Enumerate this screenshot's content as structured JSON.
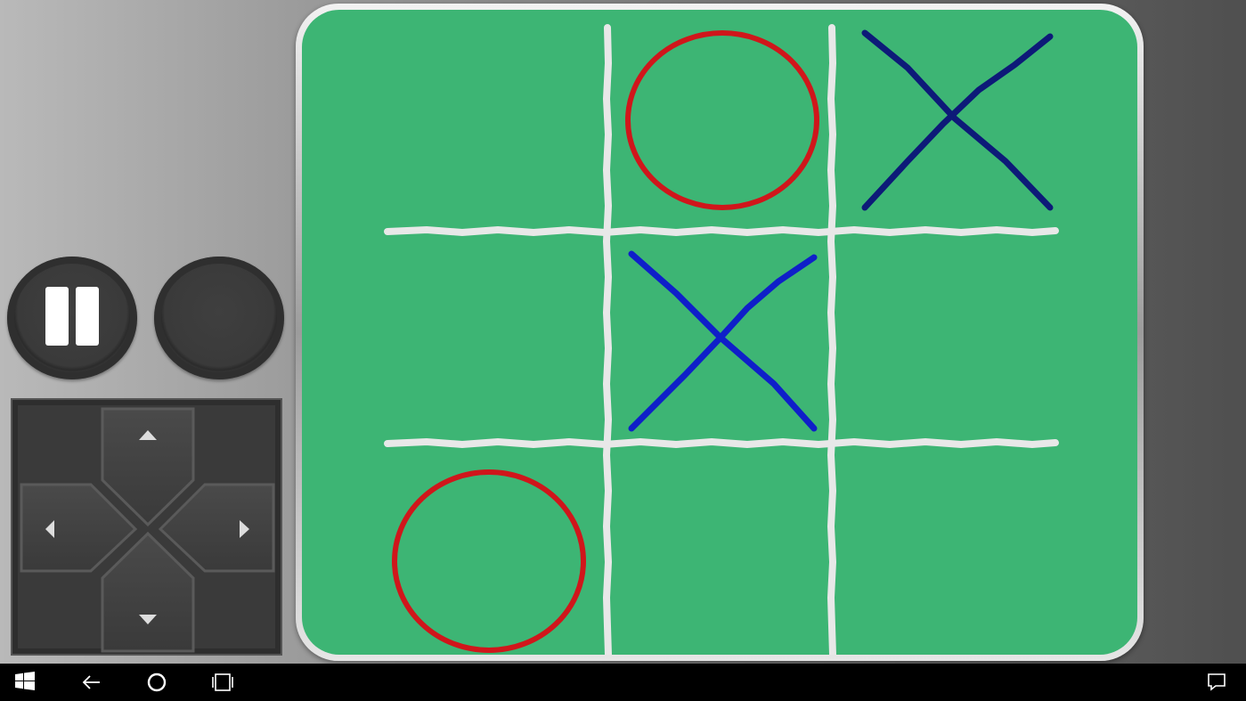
{
  "game": {
    "name": "tic-tac-toe",
    "colors": {
      "board": "#3db574",
      "grid": "#e8e8e8",
      "o": "#d0161b",
      "x_dark": "#0d1a78",
      "x": "#0f1fc9"
    },
    "board": [
      [
        "",
        "O",
        "X"
      ],
      [
        "",
        "X",
        ""
      ],
      [
        "O",
        "",
        ""
      ]
    ]
  },
  "controls": {
    "pause_icon": "pause-icon",
    "dpad": [
      "up-arrow-icon",
      "down-arrow-icon",
      "left-arrow-icon",
      "right-arrow-icon"
    ]
  },
  "taskbar": {
    "icons": [
      "windows-start-icon",
      "back-arrow-icon",
      "cortana-circle-icon",
      "task-view-icon",
      "action-center-icon"
    ]
  }
}
